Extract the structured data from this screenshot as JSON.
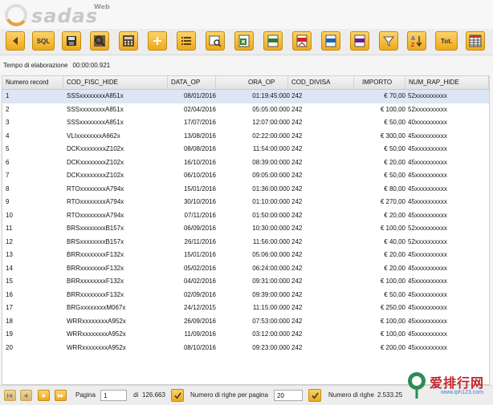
{
  "app": {
    "logo_text": "sadas",
    "logo_badge": "Web"
  },
  "toolbar": {
    "buttons": [
      {
        "name": "back-button",
        "icon": "arrow-left-icon",
        "label": ""
      },
      {
        "name": "sql-button",
        "icon": "",
        "label": "SQL"
      },
      {
        "name": "save-button",
        "icon": "floppy-disk-icon",
        "label": ""
      },
      {
        "name": "search-button",
        "icon": "magnifier-icon",
        "label": ""
      },
      {
        "name": "calculator-button",
        "icon": "calculator-icon",
        "label": ""
      },
      {
        "name": "add-button",
        "icon": "plus-icon",
        "label": ""
      },
      {
        "name": "list-button",
        "icon": "list-icon",
        "label": ""
      },
      {
        "name": "report-search-button",
        "icon": "report-search-icon",
        "label": ""
      },
      {
        "name": "export-excel-button",
        "icon": "excel-icon",
        "label": ""
      },
      {
        "name": "export-csv-button",
        "icon": "csv-icon",
        "label": ""
      },
      {
        "name": "export-pdf-button",
        "icon": "pdf-icon",
        "label": ""
      },
      {
        "name": "export-txt-button",
        "icon": "txt-icon",
        "label": ""
      },
      {
        "name": "export-dbf-button",
        "icon": "dbf-icon",
        "label": ""
      },
      {
        "name": "filter-button",
        "icon": "funnel-icon",
        "label": ""
      },
      {
        "name": "sort-button",
        "icon": "sort-az-icon",
        "label": ""
      },
      {
        "name": "totals-button",
        "icon": "",
        "label": "Tot."
      },
      {
        "name": "table-view-button",
        "icon": "table-icon",
        "label": ""
      }
    ]
  },
  "elaboration": {
    "label": "Tempo di elaborazione",
    "value": "00:00:00.921"
  },
  "table": {
    "columns": [
      "Numero record",
      "COD_FISC_HIDE",
      "DATA_OP",
      "ORA_OP",
      "COD_DIVISA",
      "IMPORTO",
      "NUM_RAP_HIDE"
    ],
    "rows": [
      [
        "1",
        "SSSxxxxxxxxA851x",
        "08/01/2016",
        "01:19:45:000",
        "242",
        "€ 70,00",
        "52xxxxxxxxxx"
      ],
      [
        "2",
        "SSSxxxxxxxxA851x",
        "02/04/2016",
        "05:05:00:000",
        "242",
        "€ 100,00",
        "52xxxxxxxxxx"
      ],
      [
        "3",
        "SSSxxxxxxxxA851x",
        "17/07/2016",
        "12:07:00:000",
        "242",
        "€ 50,00",
        "40xxxxxxxxxx"
      ],
      [
        "4",
        "VLIxxxxxxxxA662x",
        "13/08/2016",
        "02:22:00:000",
        "242",
        "€ 300,00",
        "45xxxxxxxxxx"
      ],
      [
        "5",
        "DCKxxxxxxxxZ102x",
        "08/08/2016",
        "11:54:00:000",
        "242",
        "€ 50,00",
        "45xxxxxxxxxx"
      ],
      [
        "6",
        "DCKxxxxxxxxZ102x",
        "16/10/2016",
        "08:39:00:000",
        "242",
        "€ 20,00",
        "45xxxxxxxxxx"
      ],
      [
        "7",
        "DCKxxxxxxxxZ102x",
        "06/10/2016",
        "09:05:00:000",
        "242",
        "€ 50,00",
        "45xxxxxxxxxx"
      ],
      [
        "8",
        "RTOxxxxxxxxA794x",
        "15/01/2016",
        "01:36:00:000",
        "242",
        "€ 80,00",
        "45xxxxxxxxxx"
      ],
      [
        "9",
        "RTOxxxxxxxxA794x",
        "30/10/2016",
        "01:10:00:000",
        "242",
        "€ 270,00",
        "45xxxxxxxxxx"
      ],
      [
        "10",
        "RTOxxxxxxxxA794x",
        "07/11/2016",
        "01:50:00:000",
        "242",
        "€ 20,00",
        "45xxxxxxxxxx"
      ],
      [
        "11",
        "BRSxxxxxxxxB157x",
        "06/09/2016",
        "10:30:00:000",
        "242",
        "€ 100,00",
        "52xxxxxxxxxx"
      ],
      [
        "12",
        "BRSxxxxxxxxB157x",
        "26/11/2016",
        "11:56:00:000",
        "242",
        "€ 40,00",
        "52xxxxxxxxxx"
      ],
      [
        "13",
        "BRRxxxxxxxxF132x",
        "15/01/2016",
        "05:06:00:000",
        "242",
        "€ 20,00",
        "45xxxxxxxxxx"
      ],
      [
        "14",
        "BRRxxxxxxxxF132x",
        "05/02/2016",
        "06:24:00:000",
        "242",
        "€ 20,00",
        "45xxxxxxxxxx"
      ],
      [
        "15",
        "BRRxxxxxxxxF132x",
        "04/02/2016",
        "09:31:00:000",
        "242",
        "€ 100,00",
        "45xxxxxxxxxx"
      ],
      [
        "16",
        "BRRxxxxxxxxF132x",
        "02/09/2016",
        "09:39:00:000",
        "242",
        "€ 50,00",
        "45xxxxxxxxxx"
      ],
      [
        "17",
        "BRGxxxxxxxxM067x",
        "24/12/2015",
        "11:15:00:000",
        "242",
        "€ 250,00",
        "45xxxxxxxxxx"
      ],
      [
        "18",
        "WRRxxxxxxxxA952x",
        "26/09/2016",
        "07:53:00:000",
        "242",
        "€ 100,00",
        "45xxxxxxxxxx"
      ],
      [
        "19",
        "WRRxxxxxxxxA952x",
        "11/09/2016",
        "03:12:00:000",
        "242",
        "€ 100,00",
        "45xxxxxxxxxx"
      ],
      [
        "20",
        "WRRxxxxxxxxA952x",
        "08/10/2016",
        "09:23:00:000",
        "242",
        "€ 200,00",
        "45xxxxxxxxxx"
      ]
    ],
    "selected_row": 0
  },
  "footer": {
    "page_label": "Pagina",
    "page_value": "1",
    "of_label": "di",
    "total_pages": "126.663",
    "rows_per_page_label": "Numero di righe per pagina",
    "rows_per_page_value": "20",
    "rows_count_label": "Numero di righe",
    "rows_count_value": "2.533.25"
  },
  "watermark": {
    "text": "爱排行网",
    "url": "www.iph123.com"
  },
  "colors": {
    "accent": "#f0a818",
    "selected_row": "#dde6f5",
    "logo_orange": "#e8a23a"
  }
}
